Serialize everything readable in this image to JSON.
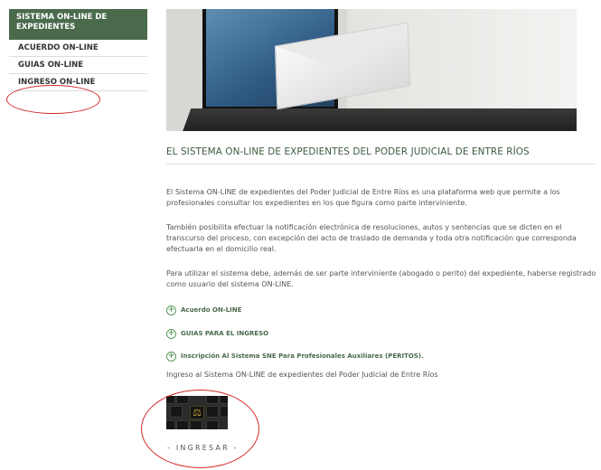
{
  "sidebar": {
    "header": "SISTEMA ON-LINE DE EXPEDIENTES",
    "items": [
      {
        "label": "ACUERDO ON-LINE"
      },
      {
        "label": "GUIAS ON-LINE"
      },
      {
        "label": "INGRESO ON-LINE"
      }
    ]
  },
  "main": {
    "title": "EL SISTEMA ON-LINE DE EXPEDIENTES DEL PODER JUDICIAL DE ENTRE RÍOS",
    "paragraphs": [
      "El Sistema ON-LINE de expedientes del Poder Judicial de Entre Ríos es una plataforma web que permite a los profesionales consultar los expedientes en los que figura como parte interviniente.",
      "También posibilita efectuar la notificación electrónica de resoluciones, autos y sentencias que se dicten en el transcurso del proceso, con excepción del acto de traslado de demanda y toda otra notificación que corresponda efectuarla en el domicilio real.",
      "Para utilizar el sistema debe, además de ser parte interviniente (abogado o perito) del expediente, haberse registrado como usuario del sistema ON-LINE."
    ],
    "links": [
      {
        "label": "Acuerdo ON-LINE"
      },
      {
        "label": "GUIAS PARA EL INGRESO"
      },
      {
        "label": "Inscripción Al Sistema SNE Para Profesionales Auxiliares (PERITOS)."
      }
    ],
    "ingreso_text": "Ingreso al  Sistema ON-LINE de expedientes del Poder Judicial de Entre Ríos",
    "ingresar_label": "- INGRESAR -"
  },
  "colors": {
    "sidebar_header_bg": "#4a6a4c",
    "link_green": "#4a6a4c",
    "annotation_red": "#d42a2a"
  }
}
